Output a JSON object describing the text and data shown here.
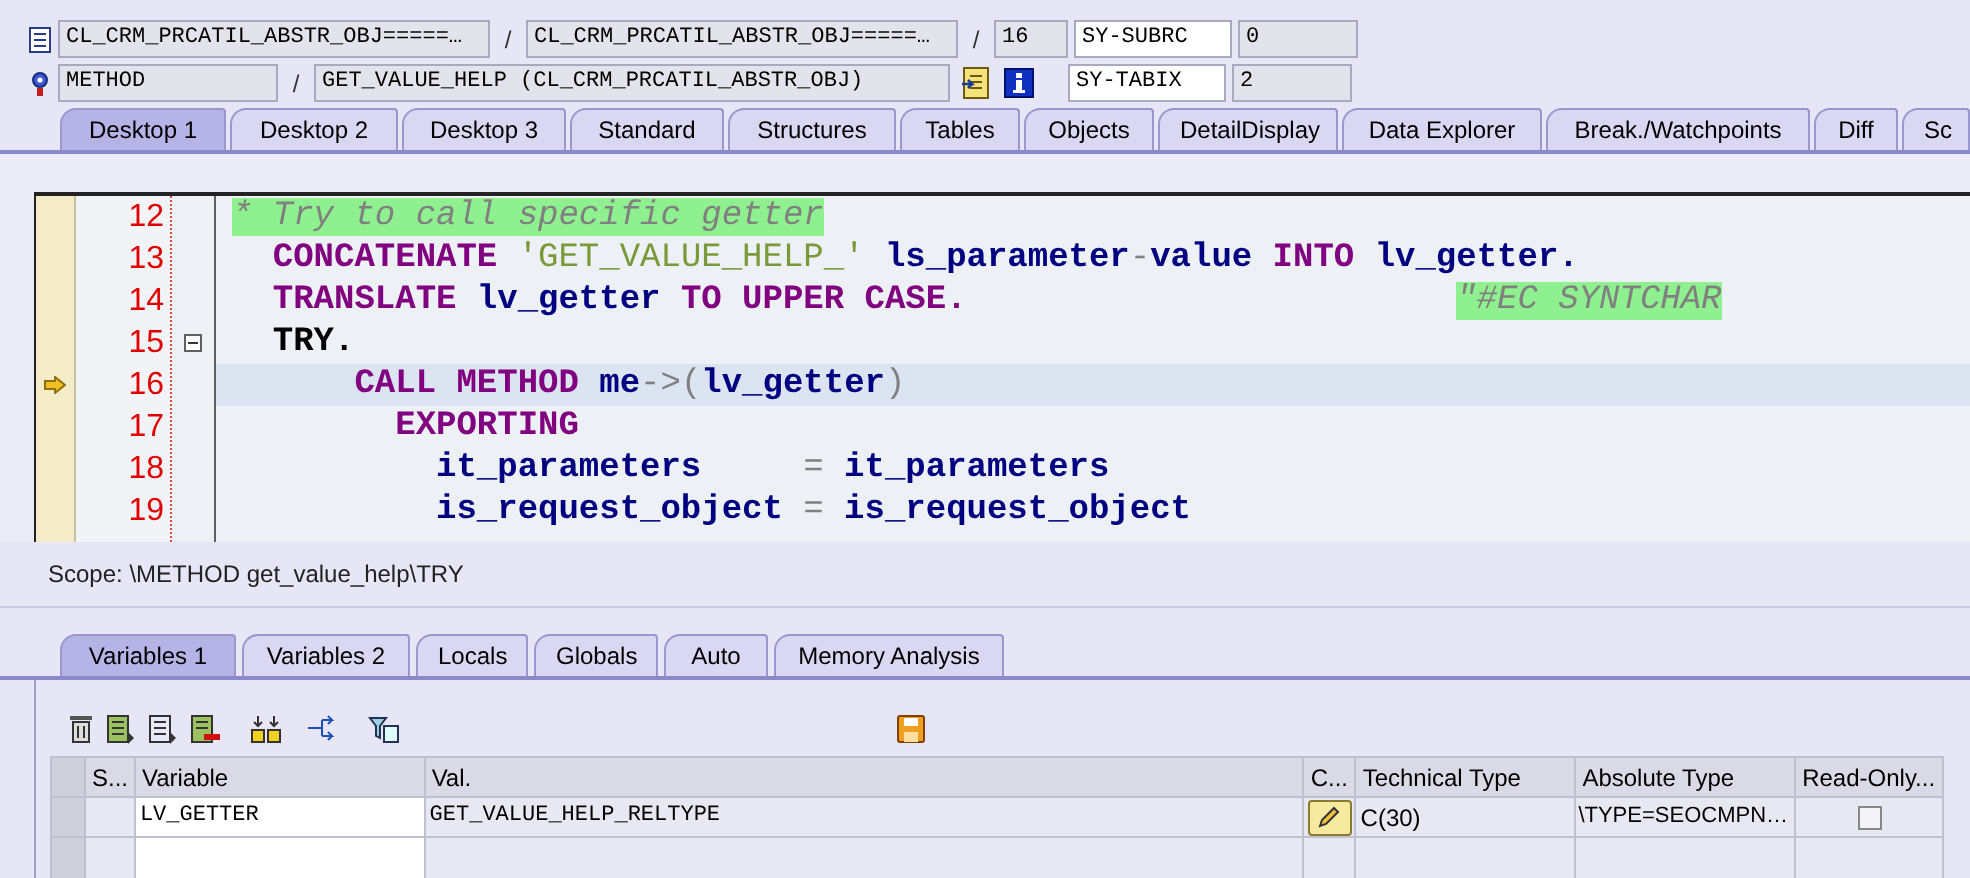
{
  "source_position": {
    "include": "CL_CRM_PRCATIL_ABSTR_OBJ=====…",
    "program": "CL_CRM_PRCATIL_ABSTR_OBJ=====…",
    "line": "16"
  },
  "path_separators": [
    "/",
    "/",
    "/"
  ],
  "event": {
    "type": "METHOD",
    "name": "GET_VALUE_HELP (CL_CRM_PRCATIL_ABSTR_OBJ)"
  },
  "system_fields": [
    {
      "name": "SY-SUBRC",
      "value": "0"
    },
    {
      "name": "SY-TABIX",
      "value": "2"
    }
  ],
  "desktop_tabs": [
    {
      "label": "Desktop 1",
      "selected": true
    },
    {
      "label": "Desktop 2",
      "selected": false
    },
    {
      "label": "Desktop 3",
      "selected": false
    },
    {
      "label": "Standard",
      "selected": false
    },
    {
      "label": "Structures",
      "selected": false
    },
    {
      "label": "Tables",
      "selected": false
    },
    {
      "label": "Objects",
      "selected": false
    },
    {
      "label": "DetailDisplay",
      "selected": false
    },
    {
      "label": "Data Explorer",
      "selected": false
    },
    {
      "label": "Break./Watchpoints",
      "selected": false
    },
    {
      "label": "Diff",
      "selected": false
    },
    {
      "label": "Sc",
      "selected": false
    }
  ],
  "code": {
    "lines": [
      {
        "number": "12",
        "current": false,
        "segments": [
          {
            "kind": "comment",
            "text": "* Try to call specific getter"
          }
        ]
      },
      {
        "number": "13",
        "current": false,
        "segments": [
          {
            "kind": "keyword",
            "text": "  CONCATENATE"
          },
          {
            "kind": "string",
            "text": " 'GET_VALUE_HELP_'"
          },
          {
            "kind": "ident",
            "text": " ls_parameter"
          },
          {
            "kind": "op",
            "text": "-"
          },
          {
            "kind": "ident",
            "text": "value"
          },
          {
            "kind": "keyword",
            "text": " INTO"
          },
          {
            "kind": "ident",
            "text": " lv_getter."
          }
        ]
      },
      {
        "number": "14",
        "current": false,
        "segments": [
          {
            "kind": "keyword",
            "text": "  TRANSLATE"
          },
          {
            "kind": "ident",
            "text": " lv_getter"
          },
          {
            "kind": "keyword",
            "text": " TO UPPER CASE.                        "
          },
          {
            "kind": "comment",
            "text": "\"#EC SYNTCHAR"
          }
        ]
      },
      {
        "number": "15",
        "current": false,
        "fold_expanded": true,
        "segments": [
          {
            "kind": "block",
            "text": "  TRY."
          }
        ]
      },
      {
        "number": "16",
        "current": true,
        "segments": [
          {
            "kind": "keyword",
            "text": "      CALL METHOD"
          },
          {
            "kind": "ident",
            "text": " me"
          },
          {
            "kind": "op",
            "text": "->("
          },
          {
            "kind": "ident",
            "text": "lv_getter"
          },
          {
            "kind": "op",
            "text": ")"
          }
        ]
      },
      {
        "number": "17",
        "current": false,
        "segments": [
          {
            "kind": "keyword",
            "text": "        EXPORTING"
          }
        ]
      },
      {
        "number": "18",
        "current": false,
        "segments": [
          {
            "kind": "ident",
            "text": "          it_parameters     "
          },
          {
            "kind": "op",
            "text": "="
          },
          {
            "kind": "ident",
            "text": " it_parameters"
          }
        ]
      },
      {
        "number": "19",
        "current": false,
        "segments": [
          {
            "kind": "ident",
            "text": "          is_request_object "
          },
          {
            "kind": "op",
            "text": "="
          },
          {
            "kind": "ident",
            "text": " is_request_object"
          }
        ]
      }
    ]
  },
  "scope": "Scope: \\METHOD get_value_help\\TRY",
  "variable_tabs": [
    {
      "label": "Variables 1",
      "selected": true
    },
    {
      "label": "Variables 2",
      "selected": false
    },
    {
      "label": "Locals",
      "selected": false
    },
    {
      "label": "Globals",
      "selected": false
    },
    {
      "label": "Auto",
      "selected": false
    },
    {
      "label": "Memory Analysis",
      "selected": false
    }
  ],
  "variables_table": {
    "columns": [
      "S...",
      "Variable",
      "Val.",
      "C...",
      "Technical Type",
      "Absolute Type",
      "Read-Only..."
    ],
    "rows": [
      {
        "variable": "LV_GETTER",
        "value": "GET_VALUE_HELP_RELTYPE",
        "technical_type": "C(30)",
        "absolute_type": "\\TYPE=SEOCMPN…",
        "read_only": false
      }
    ]
  }
}
